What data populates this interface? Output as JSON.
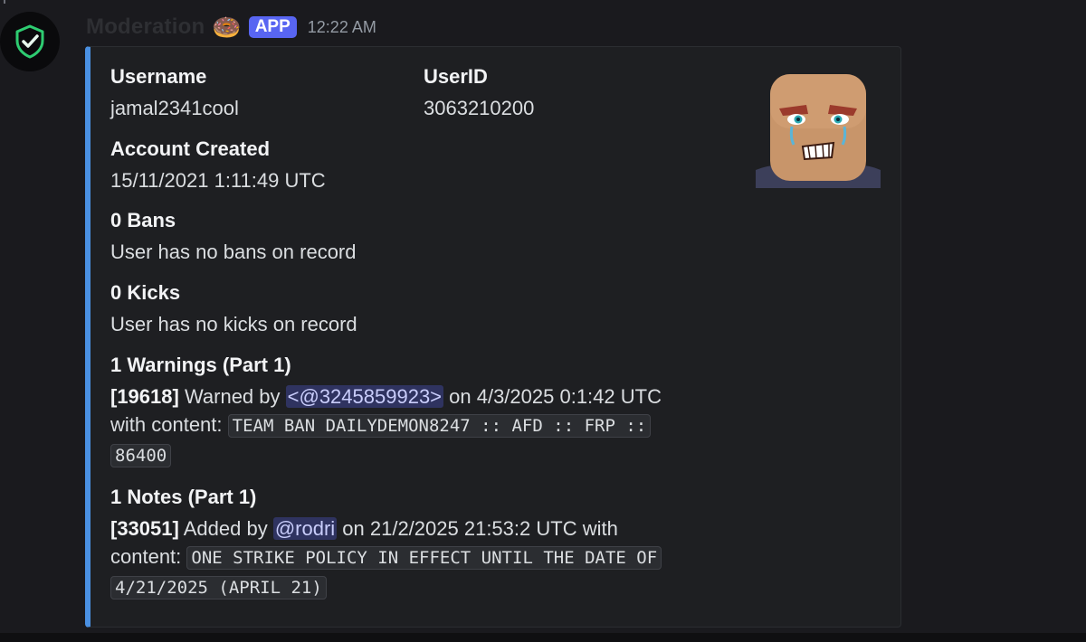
{
  "message": {
    "author": "Moderation",
    "emoji": "🍩",
    "badge": "APP",
    "timestamp": "12:22 AM"
  },
  "embed": {
    "accent_color": "#4a90e2",
    "username": {
      "label": "Username",
      "value": "jamal2341cool"
    },
    "userid": {
      "label": "UserID",
      "value": "3063210200"
    },
    "account_created": {
      "label": "Account Created",
      "value": "15/11/2021 1:11:49 UTC"
    },
    "bans": {
      "label": "0 Bans",
      "value": "User has no bans on record"
    },
    "kicks": {
      "label": "0 Kicks",
      "value": "User has no kicks on record"
    },
    "warnings": {
      "label": "1 Warnings (Part 1)",
      "id": "[19618]",
      "action": " Warned by ",
      "mention": "<@3245859923>",
      "date_text": " on 4/3/2025 0:1:42 UTC",
      "content_prefix": "with content: ",
      "code_line1": "TEAM BAN DAILYDEMON8247 :: AFD :: FRP ::",
      "code_line2": "86400"
    },
    "notes": {
      "label": "1 Notes (Part 1)",
      "id": "[33051]",
      "action": " Added by ",
      "mention": "@rodri",
      "date_text": " on 21/2/2025 21:53:2 UTC with",
      "content_prefix": "content: ",
      "code_line1": "ONE STRIKE POLICY IN EFFECT UNTIL THE DATE OF",
      "code_line2": "4/21/2025 (APRIL 21)"
    }
  },
  "icons": {
    "bot_avatar": "shield-check-icon",
    "thumbnail": "roblox-avatar-face"
  }
}
